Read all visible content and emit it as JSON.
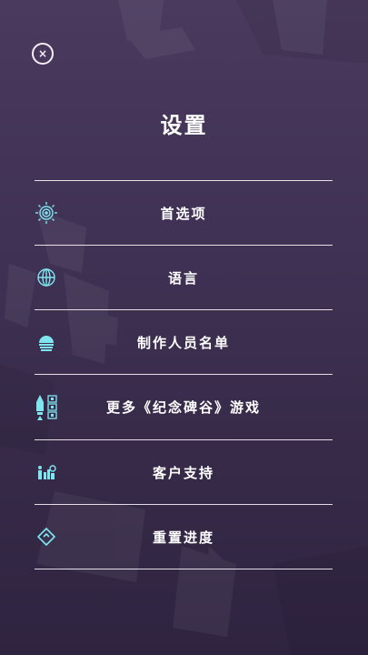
{
  "header": {
    "close_label": "×",
    "title": "设置"
  },
  "menu": {
    "items": [
      {
        "label": "首选项",
        "icon": "preferences-sun-icon"
      },
      {
        "label": "语言",
        "icon": "globe-icon"
      },
      {
        "label": "制作人员名单",
        "icon": "credits-dome-icon"
      },
      {
        "label": "更多《纪念碑谷》游戏",
        "icon": "rocket-qr-icon"
      },
      {
        "label": "客户支持",
        "icon": "support-person-icon"
      },
      {
        "label": "重置进度",
        "icon": "reset-cube-icon"
      }
    ]
  },
  "colors": {
    "icon_accent": "#7fe6f0",
    "divider": "#ffffff",
    "background_top": "#4a3a5e",
    "background_bottom": "#2f2440"
  }
}
